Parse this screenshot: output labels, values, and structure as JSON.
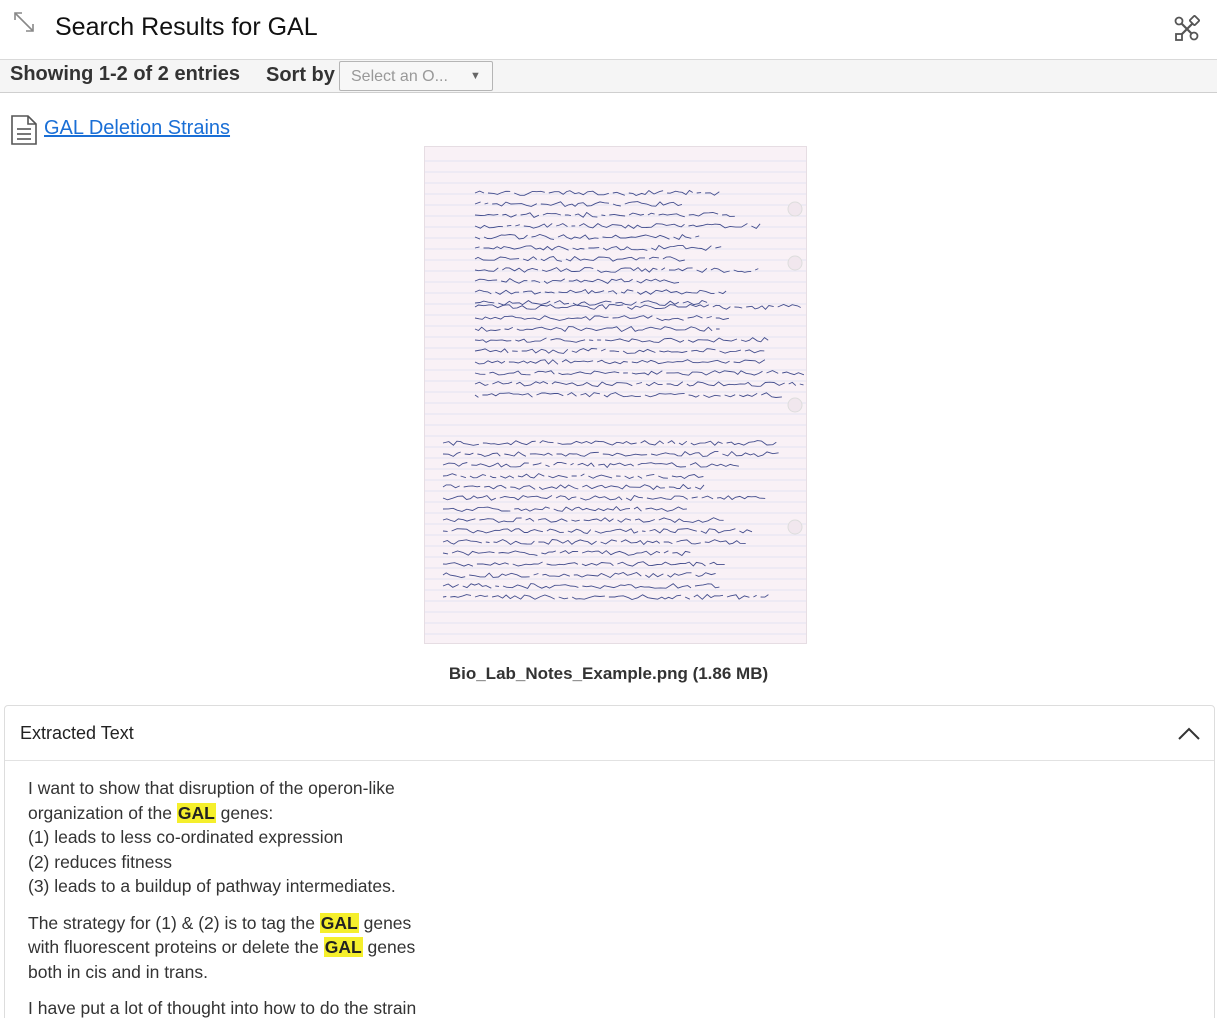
{
  "header": {
    "title": "Search Results for GAL"
  },
  "toolbar": {
    "showing": "Showing 1-2 of 2 entries",
    "sort_label": "Sort by",
    "sort_placeholder": "Select an O..."
  },
  "result": {
    "link_text": "GAL Deletion Strains",
    "file_caption": "Bio_Lab_Notes_Example.png (1.86 MB)"
  },
  "panel": {
    "title": "Extracted Text",
    "paragraphs": [
      {
        "lines": [
          [
            {
              "t": "I want to show that disruption of the operon-like"
            }
          ],
          [
            {
              "t": "organization of the "
            },
            {
              "t": "GAL",
              "hl": true
            },
            {
              "t": " genes:"
            }
          ],
          [
            {
              "t": "(1) leads to less co-ordinated expression"
            }
          ],
          [
            {
              "t": "(2) reduces fitness"
            }
          ],
          [
            {
              "t": "(3) leads to a buildup of pathway intermediates."
            }
          ]
        ]
      },
      {
        "lines": [
          [
            {
              "t": "The strategy for (1) & (2) is to tag the "
            },
            {
              "t": "GAL",
              "hl": true
            },
            {
              "t": " genes"
            }
          ],
          [
            {
              "t": "with fluorescent proteins or delete the "
            },
            {
              "t": "GAL",
              "hl": true
            },
            {
              "t": " genes"
            }
          ],
          [
            {
              "t": "both in cis and in trans."
            }
          ]
        ]
      },
      {
        "lines": [
          [
            {
              "t": "I have put a lot of thought into how to do the strain"
            }
          ]
        ]
      }
    ]
  },
  "colors": {
    "link": "#1a6fd6",
    "highlight": "#f5ef2c",
    "paper": "#f9f1f6"
  },
  "icons": {
    "expand": "expand-arrows-icon",
    "tools": "tools-icon",
    "document": "document-icon",
    "collapse": "chevron-up-icon"
  }
}
